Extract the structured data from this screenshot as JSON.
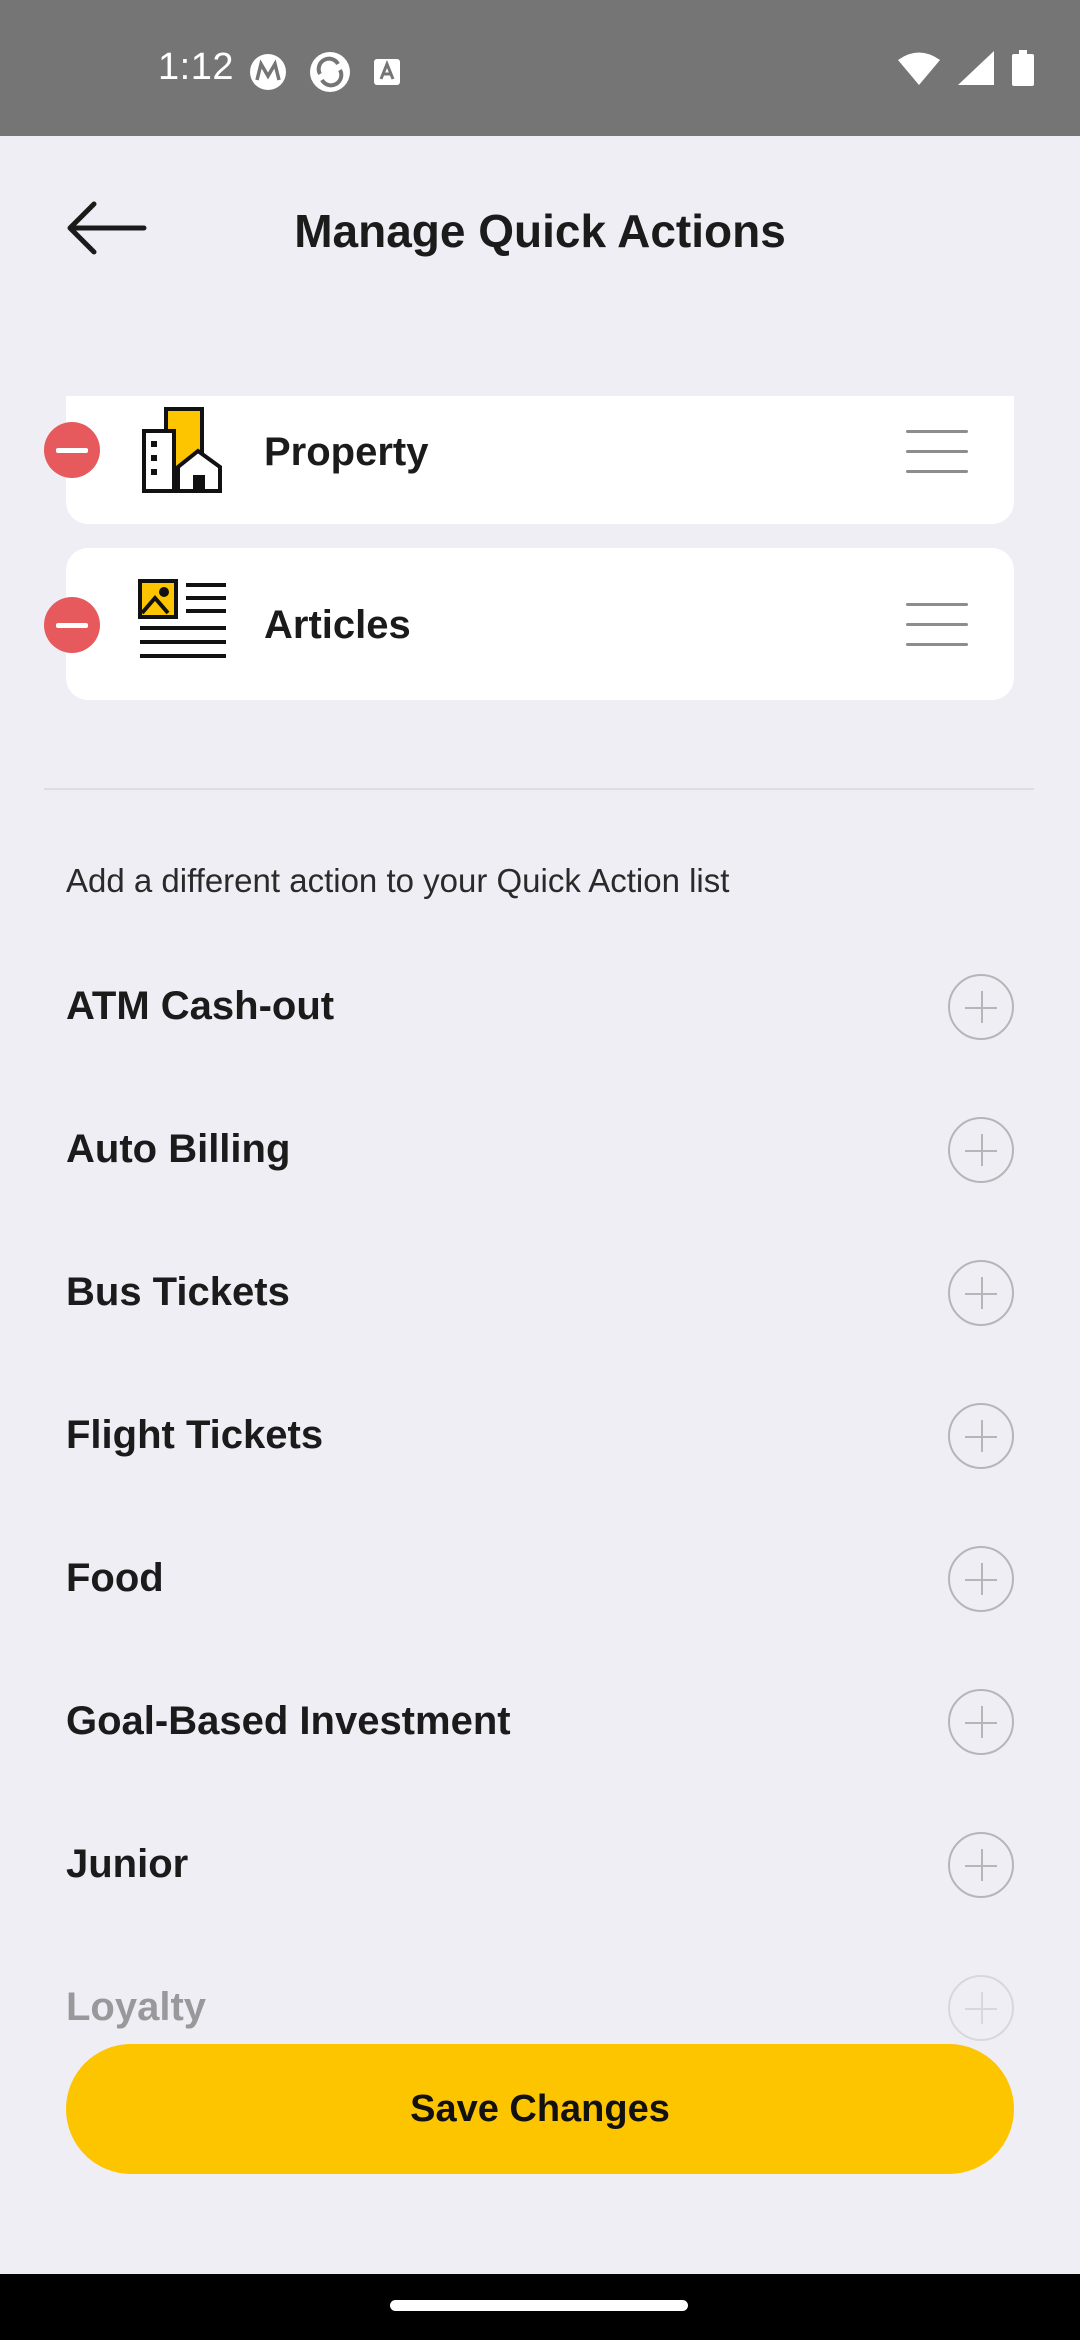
{
  "status_bar": {
    "time": "1:12",
    "left_icons": [
      "motorola-m-icon",
      "sync-icon",
      "a-badge-icon"
    ],
    "right_icons": [
      "wifi-icon",
      "signal-icon",
      "battery-icon"
    ]
  },
  "header": {
    "title": "Manage Quick Actions",
    "back_icon": "back-arrow-icon"
  },
  "quick_actions": [
    {
      "label": "Property",
      "icon": "property-icon"
    },
    {
      "label": "Articles",
      "icon": "articles-icon"
    }
  ],
  "section_hint": "Add a different action to your Quick Action list",
  "available_actions": [
    {
      "label": "ATM Cash-out"
    },
    {
      "label": "Auto Billing"
    },
    {
      "label": "Bus Tickets"
    },
    {
      "label": "Flight Tickets"
    },
    {
      "label": "Food"
    },
    {
      "label": "Goal-Based Investment"
    },
    {
      "label": "Junior"
    },
    {
      "label": "Loyalty"
    }
  ],
  "save_button": {
    "label": "Save Changes"
  },
  "colors": {
    "accent": "#fdc400",
    "remove": "#e65a5e",
    "background": "#efeef4",
    "status_bar": "#757575"
  }
}
